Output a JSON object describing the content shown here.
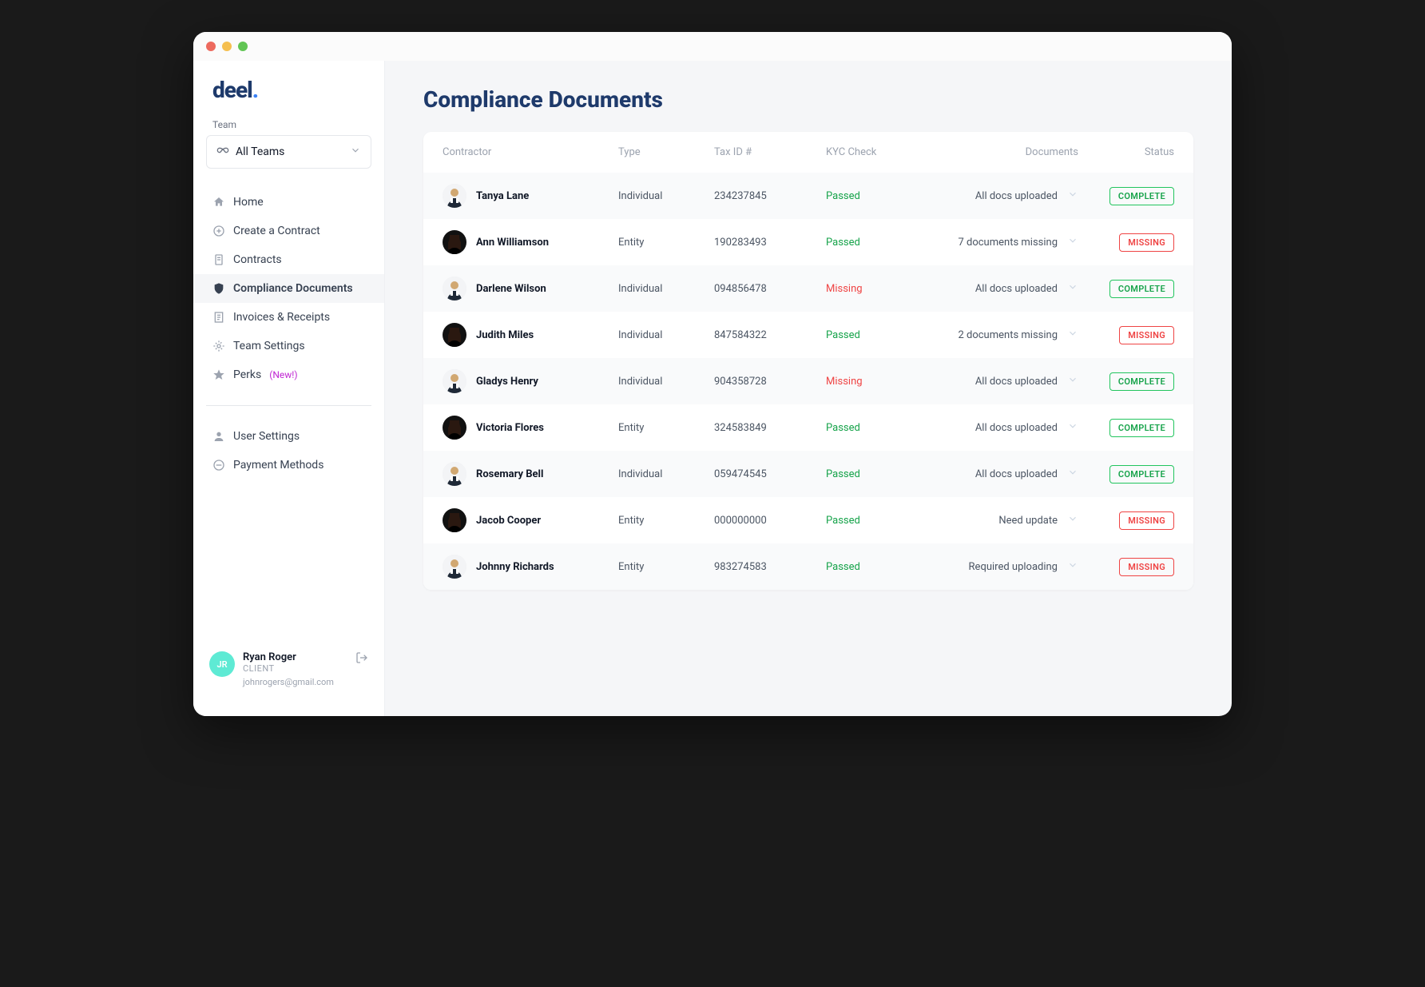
{
  "logo": "deel",
  "sidebar": {
    "team_label": "Team",
    "team_value": "All Teams",
    "nav": [
      {
        "label": "Home",
        "icon": "home"
      },
      {
        "label": "Create a Contract",
        "icon": "plus-circle"
      },
      {
        "label": "Contracts",
        "icon": "document"
      },
      {
        "label": "Compliance Documents",
        "icon": "shield"
      },
      {
        "label": "Invoices & Receipts",
        "icon": "receipt"
      },
      {
        "label": "Team Settings",
        "icon": "gear"
      },
      {
        "label": "Perks",
        "icon": "star",
        "tag": "(New!)"
      }
    ],
    "nav2": [
      {
        "label": "User Settings",
        "icon": "user"
      },
      {
        "label": "Payment Methods",
        "icon": "credit-card"
      }
    ]
  },
  "user": {
    "initials": "JR",
    "name": "Ryan Roger",
    "role": "CLIENT",
    "email": "johnrogers@gmail.com"
  },
  "page": {
    "title": "Compliance Documents",
    "columns": {
      "contractor": "Contractor",
      "type": "Type",
      "tax": "Tax ID #",
      "kyc": "KYC Check",
      "docs": "Documents",
      "status": "Status"
    },
    "rows": [
      {
        "name": "Tanya Lane",
        "type": "Individual",
        "tax": "234237845",
        "kyc": "Passed",
        "docs": "All docs uploaded",
        "status": "COMPLETE",
        "avatar": "m1"
      },
      {
        "name": "Ann Williamson",
        "type": "Entity",
        "tax": "190283493",
        "kyc": "Passed",
        "docs": "7 documents missing",
        "status": "MISSING",
        "avatar": "f1"
      },
      {
        "name": "Darlene Wilson",
        "type": "Individual",
        "tax": "094856478",
        "kyc": "Missing",
        "docs": "All docs uploaded",
        "status": "COMPLETE",
        "avatar": "m1"
      },
      {
        "name": "Judith Miles",
        "type": "Individual",
        "tax": "847584322",
        "kyc": "Passed",
        "docs": "2 documents missing",
        "status": "MISSING",
        "avatar": "f1"
      },
      {
        "name": "Gladys Henry",
        "type": "Individual",
        "tax": "904358728",
        "kyc": "Missing",
        "docs": "All docs uploaded",
        "status": "COMPLETE",
        "avatar": "m1"
      },
      {
        "name": "Victoria Flores",
        "type": "Entity",
        "tax": "324583849",
        "kyc": "Passed",
        "docs": "All docs uploaded",
        "status": "COMPLETE",
        "avatar": "f1"
      },
      {
        "name": "Rosemary Bell",
        "type": "Individual",
        "tax": "059474545",
        "kyc": "Passed",
        "docs": "All docs uploaded",
        "status": "COMPLETE",
        "avatar": "m1"
      },
      {
        "name": "Jacob Cooper",
        "type": "Entity",
        "tax": "000000000",
        "kyc": "Passed",
        "docs": "Need update",
        "status": "MISSING",
        "avatar": "f1"
      },
      {
        "name": "Johnny Richards",
        "type": "Entity",
        "tax": "983274583",
        "kyc": "Passed",
        "docs": "Required uploading",
        "status": "MISSING",
        "avatar": "m1"
      }
    ]
  }
}
